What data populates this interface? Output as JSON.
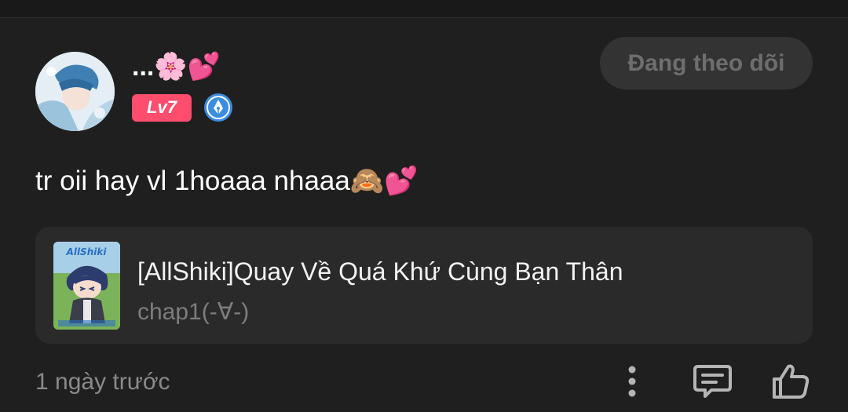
{
  "header": {
    "username": "...🌸💕",
    "level": "Lv7",
    "follow_label": "Đang theo dõi"
  },
  "comment": {
    "text": "tr oii hay vl 1hoaaa nhaaa🙈💕"
  },
  "story": {
    "title": "[AllShiki]Quay Về Quá Khứ Cùng Bạn Thân",
    "chapter": "chap1(-∀-)",
    "cover_logo_text": "AllShiki"
  },
  "footer": {
    "timestamp": "1 ngày trước"
  },
  "icons": {
    "avatar": "user-avatar",
    "creator_badge": "pen-nib-icon",
    "more": "more-vertical-icon",
    "reply": "comment-icon",
    "like": "thumbs-up-icon"
  },
  "colors": {
    "background": "#1f1f1f",
    "card": "#2a2a2a",
    "level_badge": "#ff4d6d",
    "creator_badge": "#3a8de0",
    "follow_button": "#333333",
    "muted_text": "#8a8a8a"
  }
}
